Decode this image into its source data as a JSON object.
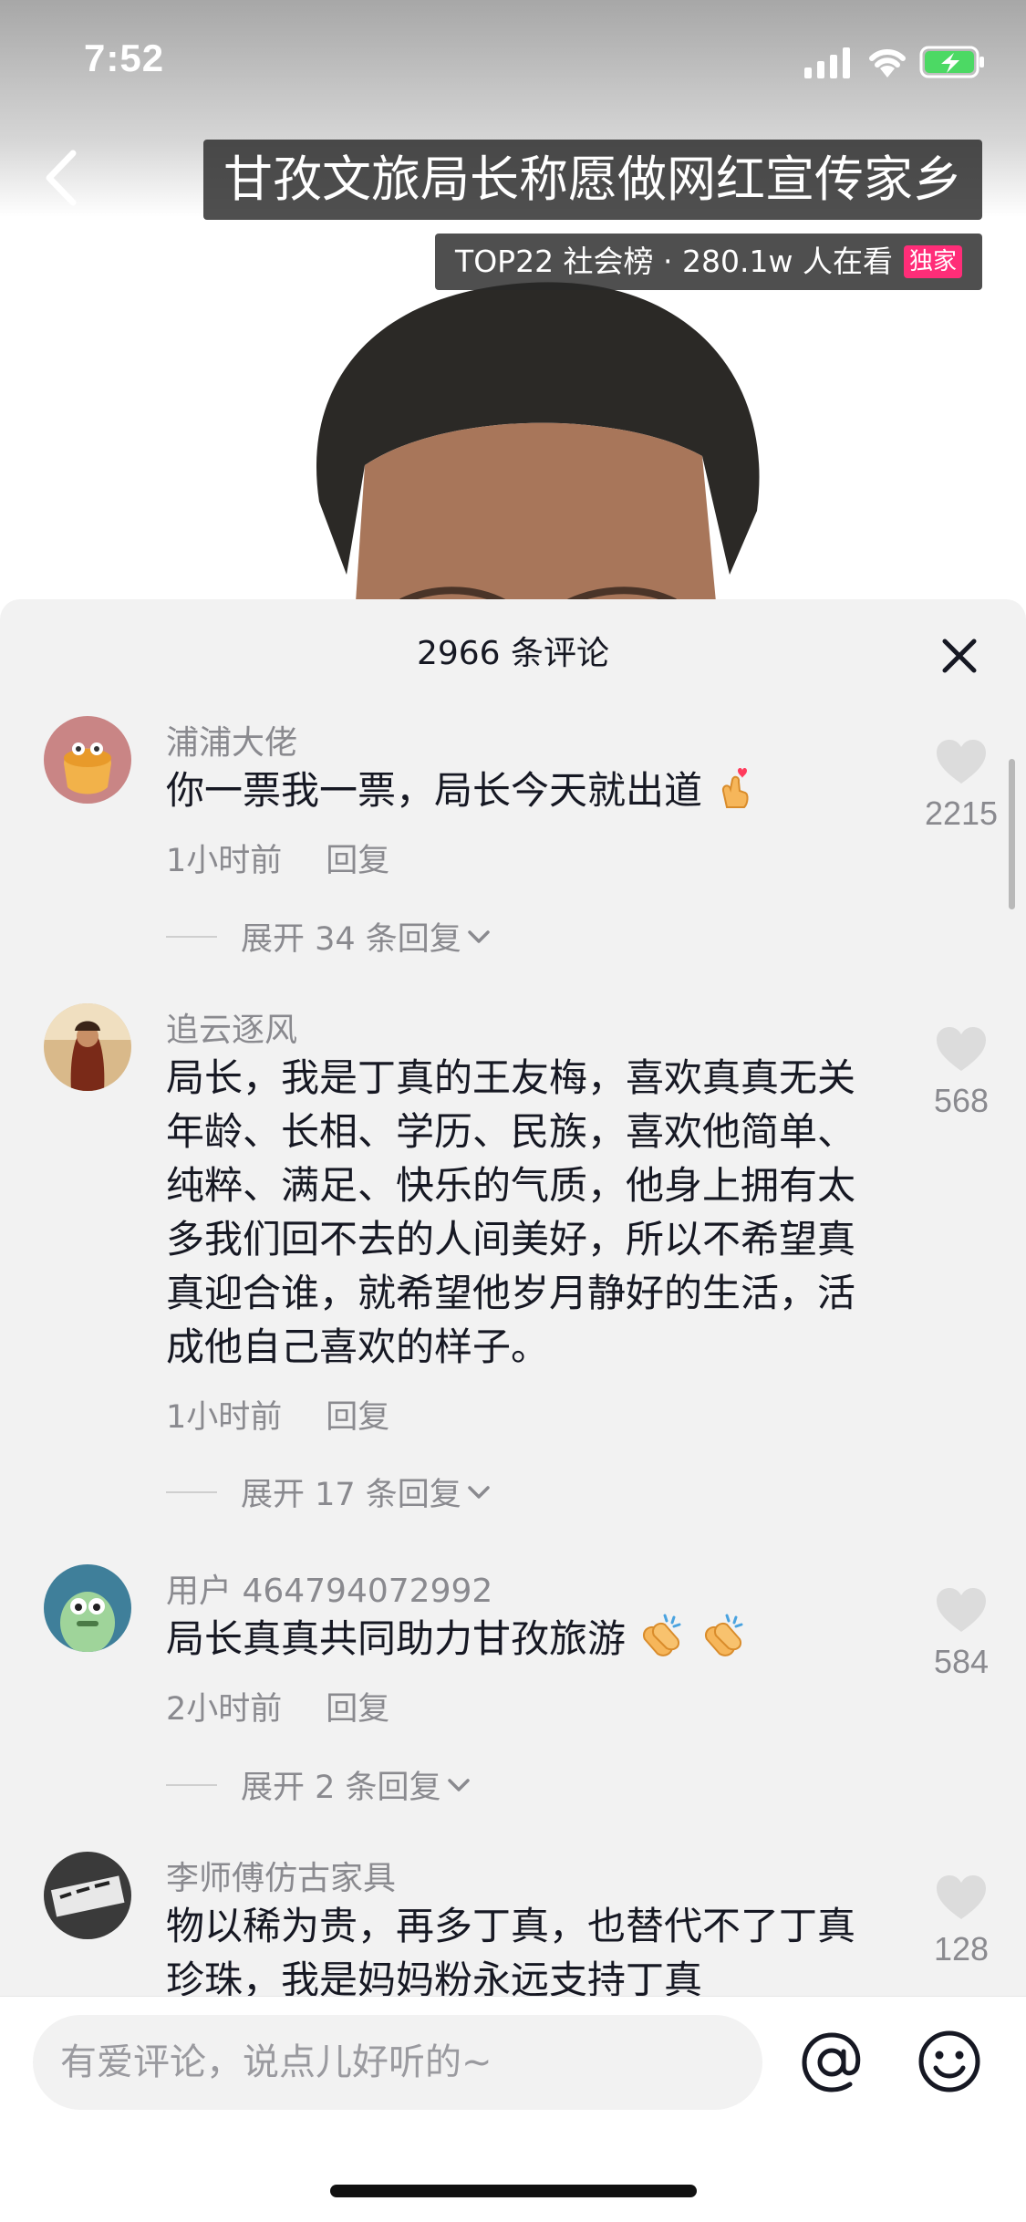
{
  "status_bar": {
    "time": "7:52"
  },
  "header": {
    "title": "甘孜文旅局长称愿做网红宣传家乡",
    "rank": "TOP22 社会榜 · 280.1w 人在看",
    "badge": "独家"
  },
  "comments_panel": {
    "title": "2966 条评论",
    "comments": [
      {
        "user": "浦浦大佬",
        "text": "你一票我一票，局长今天就出道",
        "emoji": "finger-heart",
        "time": "1小时前",
        "reply_label": "回复",
        "likes": "2215",
        "expand_label": "展开 34 条回复"
      },
      {
        "user": "追云逐风",
        "text": "局长，我是丁真的王友梅，喜欢真真无关年龄、长相、学历、民族，喜欢他简单、纯粹、满足、快乐的气质，他身上拥有太多我们回不去的人间美好，所以不希望真真迎合谁，就希望他岁月静好的生活，活成他自己喜欢的样子。",
        "time": "1小时前",
        "reply_label": "回复",
        "likes": "568",
        "expand_label": "展开 17 条回复"
      },
      {
        "user": "用户 464794072992",
        "text": "局长真真共同助力甘孜旅游",
        "emoji": "clapping-hands",
        "time": "2小时前",
        "reply_label": "回复",
        "likes": "584",
        "expand_label": "展开 2 条回复"
      },
      {
        "user": "李师傅仿古家具",
        "text": "物以稀为贵，再多丁真，也替代不了丁真珍珠，我是妈妈粉永远支持丁真",
        "likes": "128"
      }
    ]
  },
  "input_bar": {
    "placeholder": "有爱评论，说点儿好听的~"
  },
  "colors": {
    "accent_badge": "#ff2d78",
    "sheet_bg": "#f2f2f2",
    "muted_text": "#8a8a8f"
  }
}
